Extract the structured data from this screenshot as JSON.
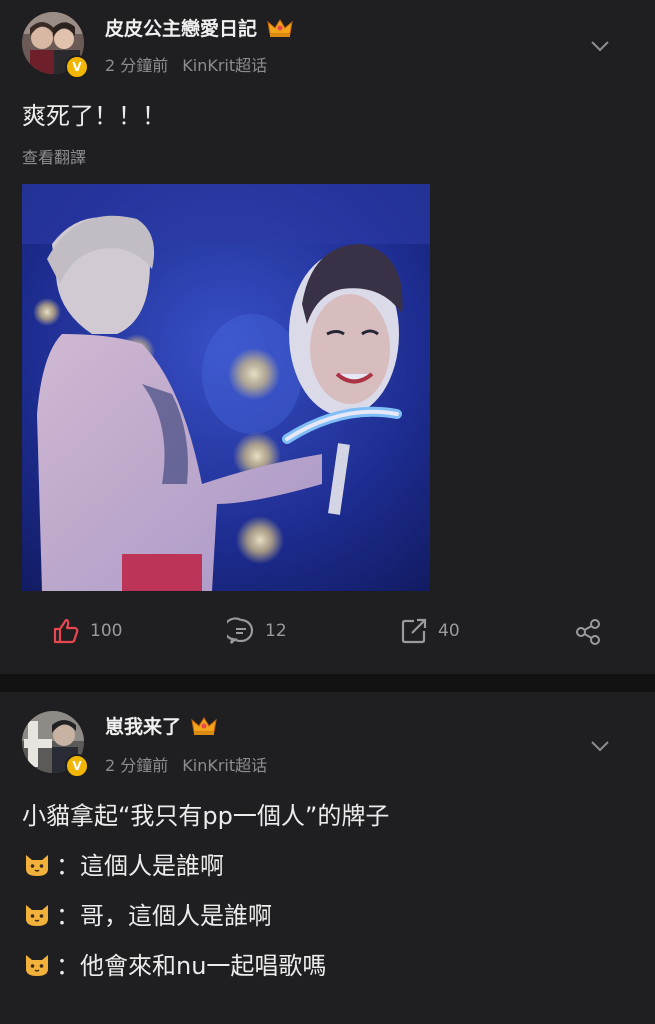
{
  "post1": {
    "username": "皮皮公主戀愛日記",
    "crown_icon": "crown-icon",
    "time": "2 分鐘前",
    "topic": "KinKrit超话",
    "content": "爽死了！！！",
    "translate": "查看翻譯",
    "photo": "concert-photo",
    "actions": {
      "likes": "100",
      "comments": "12",
      "shares": "40"
    },
    "like_color": "#e8474f"
  },
  "post2": {
    "username": "崽我来了",
    "crown_icon": "crown-icon",
    "time": "2 分鐘前",
    "topic": "KinKrit超话",
    "lines": [
      "小貓拿起“我只有pp一個人”的牌子",
      "：這個人是誰啊",
      "：哥，這個人是誰啊",
      "：他會來和nu一起唱歌嗎"
    ],
    "line_icon": "cat-face-icon"
  },
  "colors": {
    "background": "#1f1f21",
    "separator": "#121213",
    "badge": "#f2b705",
    "secondary_text": "#8d8d8f"
  }
}
